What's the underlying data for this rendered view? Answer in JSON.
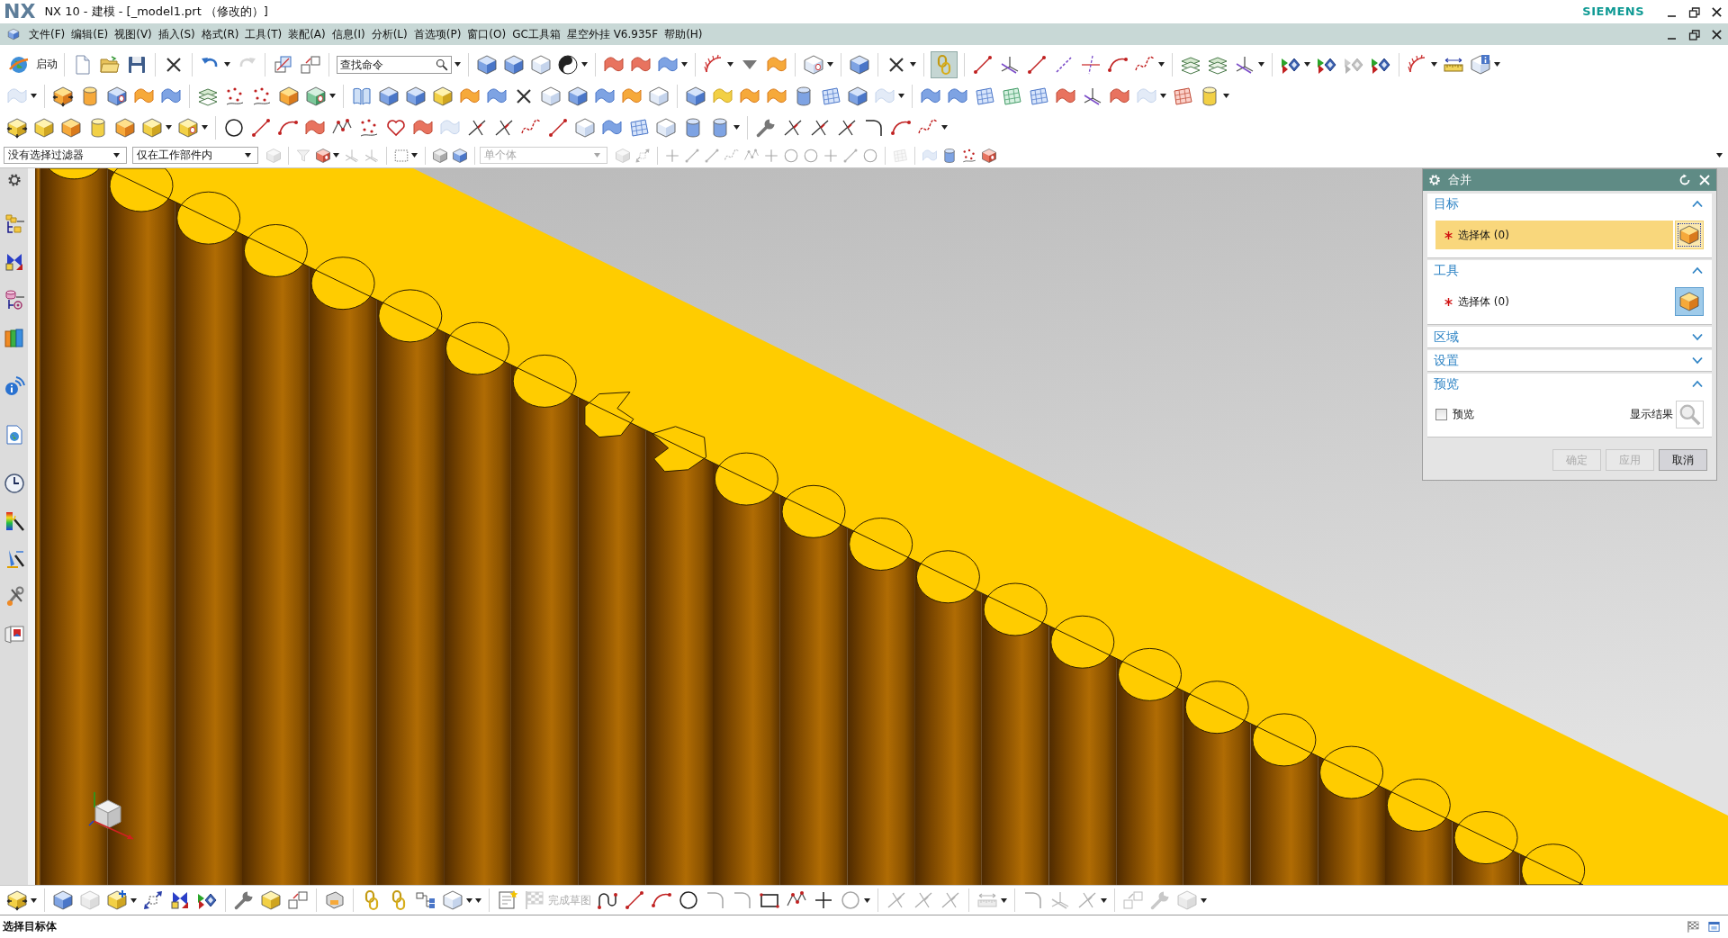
{
  "window": {
    "logo": "NX",
    "title": "NX 10 - 建模 - [_model1.prt （修改的）]",
    "brand": "SIEMENS"
  },
  "menu": [
    "文件(F)",
    "编辑(E)",
    "视图(V)",
    "插入(S)",
    "格式(R)",
    "工具(T)",
    "装配(A)",
    "信息(I)",
    "分析(L)",
    "首选项(P)",
    "窗口(O)",
    "GC工具箱",
    "星空外挂 V6.935F",
    "帮助(H)"
  ],
  "toolbar": {
    "start": "启动",
    "command_search": {
      "placeholder": "查找命令"
    },
    "snap_toggle": {
      "on": true
    }
  },
  "selection_bar": {
    "filter": "没有选择过滤器",
    "scope": "仅在工作部件内",
    "body_rule": {
      "value": "单个体",
      "disabled": true
    }
  },
  "dialog": {
    "title": "合并",
    "sections": [
      {
        "title": "目标",
        "expanded": true,
        "kind": "selector",
        "selector": {
          "label": "选择体 (0)",
          "required": true,
          "active": true
        }
      },
      {
        "title": "工具",
        "expanded": true,
        "kind": "selector",
        "selector": {
          "label": "选择体 (0)",
          "required": true,
          "active": false
        }
      },
      {
        "title": "区域",
        "expanded": false
      },
      {
        "title": "设置",
        "expanded": false
      },
      {
        "title": "预览",
        "expanded": true,
        "kind": "preview",
        "preview": {
          "checkbox_label": "预览",
          "checked": false,
          "result_label": "显示结果"
        }
      }
    ],
    "buttons": [
      {
        "label": "确定",
        "disabled": true
      },
      {
        "label": "应用",
        "disabled": true
      },
      {
        "label": "取消",
        "disabled": false
      }
    ]
  },
  "sketch_toolbar": {
    "finish_sketch": {
      "label": "完成草图",
      "disabled": true
    }
  },
  "status_bar": {
    "message": "选择目标体"
  }
}
